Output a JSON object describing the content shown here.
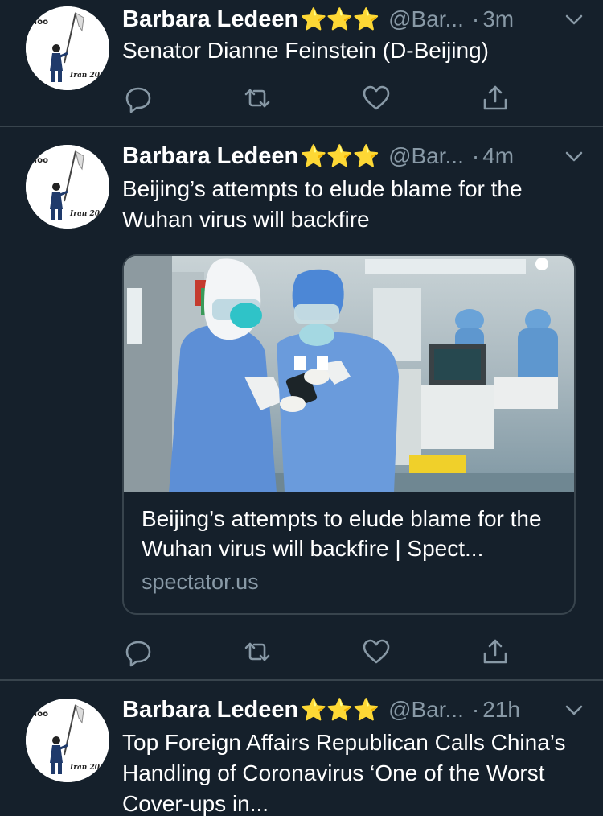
{
  "colors": {
    "background": "#15202b",
    "divider": "#38444d",
    "secondary_text": "#8899a6",
    "star": "#f5c518",
    "icon": "#8899a6"
  },
  "tweets": [
    {
      "display_name": "Barbara Ledeen",
      "stars": "⭐⭐⭐",
      "handle": "@Bar...",
      "dot": "·",
      "time": "3m",
      "text": "Senator Dianne Feinstein (D-Beijing)",
      "avatar_text": [
        "eToo",
        "Iran 20"
      ]
    },
    {
      "display_name": "Barbara Ledeen",
      "stars": "⭐⭐⭐",
      "handle": "@Bar...",
      "dot": "·",
      "time": "4m",
      "text": "Beijing’s attempts to elude blame for the Wuhan virus will backfire",
      "avatar_text": [
        "eToo",
        "Iran 20"
      ],
      "card": {
        "title": "Beijing’s attempts to elude blame for the Wuhan virus will backfire | Spect...",
        "domain": "spectator.us"
      }
    },
    {
      "display_name": "Barbara Ledeen",
      "stars": "⭐⭐⭐",
      "handle": "@Bar...",
      "dot": "·",
      "time": "21h",
      "text": "Top Foreign Affairs Republican Calls China’s Handling of Coronavirus ‘One of the Worst Cover-ups in...",
      "avatar_text": [
        "eToo",
        "Iran 20"
      ]
    }
  ],
  "icons": {
    "reply": "reply-icon",
    "retweet": "retweet-icon",
    "like": "heart-icon",
    "share": "share-icon",
    "menu": "chevron-down-icon"
  }
}
